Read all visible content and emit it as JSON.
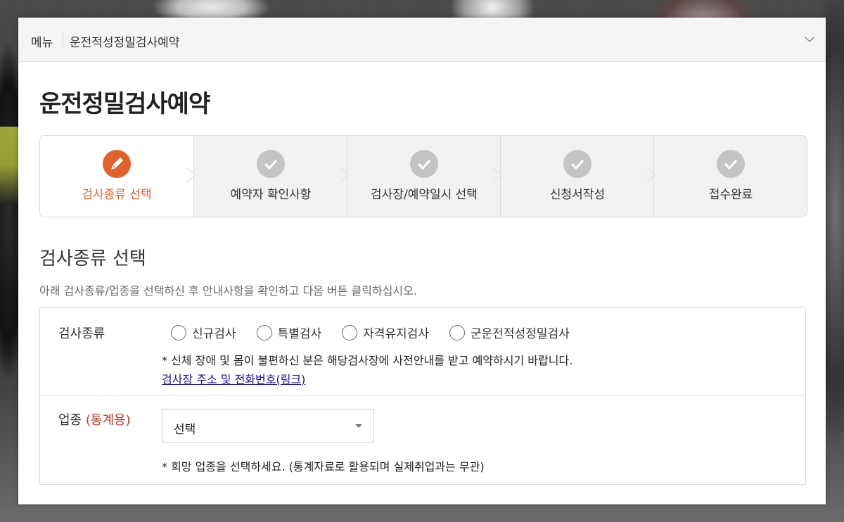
{
  "breadcrumb": {
    "menu_label": "메뉴",
    "current": "운전적성정밀검사예약"
  },
  "page_title": "운전정밀검사예약",
  "steps": [
    {
      "label": "검사종류 선택",
      "state": "active",
      "icon": "pencil-icon"
    },
    {
      "label": "예약자 확인사항",
      "state": "pending",
      "icon": "check-icon"
    },
    {
      "label": "검사장/예약일시 선택",
      "state": "pending",
      "icon": "check-icon"
    },
    {
      "label": "신청서작성",
      "state": "pending",
      "icon": "check-icon"
    },
    {
      "label": "접수완료",
      "state": "pending",
      "icon": "check-icon"
    }
  ],
  "section": {
    "title": "검사종류 선택",
    "description": "아래 검사종류/업종을 선택하신 후 안내사항을 확인하고 다음 버튼 클릭하십시오."
  },
  "exam_type": {
    "label": "검사종류",
    "options": [
      "신규검사",
      "특별검사",
      "자격유지검사",
      "군운전적성정밀검사"
    ],
    "note": "* 신체 장애 및 몸이 불편하신 분은 해당검사장에 사전안내를 받고 예약하시기 바랍니다.",
    "link_text": "검사장 주소 및 전화번호(링크)"
  },
  "industry": {
    "label": "업종",
    "label_suffix": "(통계용)",
    "selected": "선택",
    "note": "* 희망 업종을 선택하세요. (통계자료로 활용되며 실제취업과는 무관)"
  },
  "colors": {
    "accent": "#e0612b",
    "inactive_step": "#c4c4c4",
    "link": "#1a0dab",
    "stat_label": "#c0392b"
  }
}
